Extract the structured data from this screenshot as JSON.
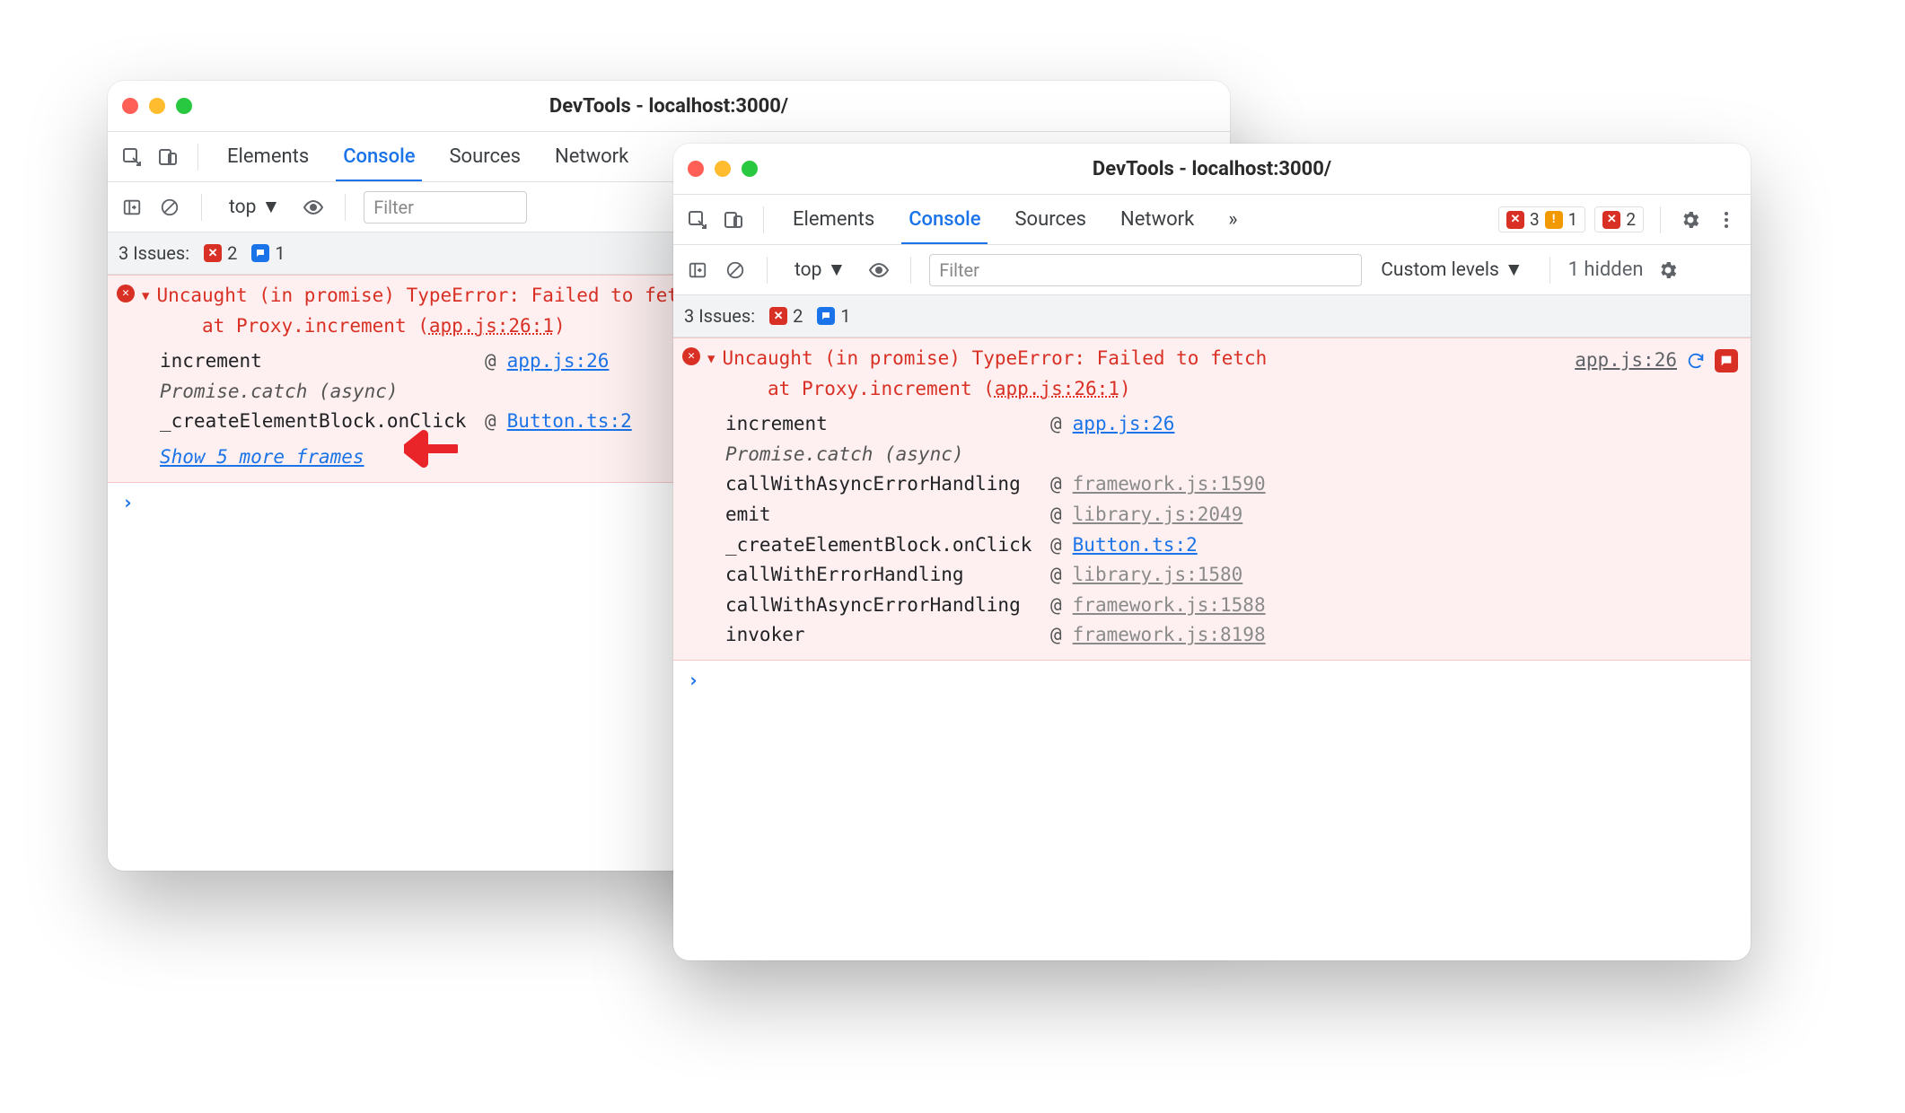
{
  "windows": {
    "w1": {
      "title": "DevTools - localhost:3000/"
    },
    "w2": {
      "title": "DevTools - localhost:3000/"
    }
  },
  "tabs": {
    "elements": "Elements",
    "console": "Console",
    "sources": "Sources",
    "network": "Network",
    "more_glyph": "»"
  },
  "toolbar": {
    "context": "top",
    "filter_placeholder": "Filter",
    "levels_w2": "Custom levels",
    "hidden_w2": "1 hidden"
  },
  "counts": {
    "w2": {
      "errors": "3",
      "warnings": "1",
      "repeats": "2"
    }
  },
  "issues": {
    "label": "3 Issues:",
    "err": "2",
    "msg": "1"
  },
  "error": {
    "line1": "Uncaught (in promise) TypeError: Failed to fetch",
    "line2_pre": "at Proxy.increment (",
    "line2_loc": "app.js:26:1",
    "line2_suf": ")",
    "src_link": "app.js:26",
    "async_label": "Promise.catch (async)",
    "at_glyph": "@"
  },
  "trace_w1": [
    {
      "fn": "increment",
      "loc": "app.js:26",
      "third": false
    },
    {
      "async": true
    },
    {
      "fn": "_createElementBlock.onClick",
      "loc": "Button.ts:2",
      "third": false
    }
  ],
  "show_more_w1": "Show 5 more frames",
  "trace_w2": [
    {
      "fn": "increment",
      "loc": "app.js:26",
      "third": false
    },
    {
      "async": true
    },
    {
      "fn": "callWithAsyncErrorHandling",
      "loc": "framework.js:1590",
      "third": true
    },
    {
      "fn": "emit",
      "loc": "library.js:2049",
      "third": true
    },
    {
      "fn": "_createElementBlock.onClick",
      "loc": "Button.ts:2",
      "third": false
    },
    {
      "fn": "callWithErrorHandling",
      "loc": "library.js:1580",
      "third": true
    },
    {
      "fn": "callWithAsyncErrorHandling",
      "loc": "framework.js:1588",
      "third": true
    },
    {
      "fn": "invoker",
      "loc": "framework.js:8198",
      "third": true
    }
  ],
  "prompt_glyph": "›"
}
